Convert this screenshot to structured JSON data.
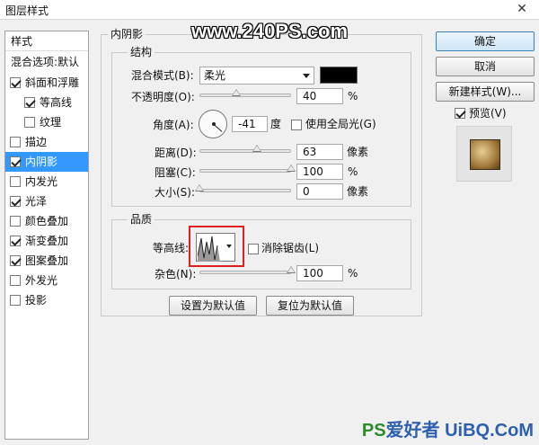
{
  "window": {
    "title": "图层样式",
    "close_glyph": "✕"
  },
  "watermark_top": "www.240PS.com",
  "sidebar": {
    "header": "样式",
    "blend_options": "混合选项:默认",
    "items": [
      {
        "label": "斜面和浮雕",
        "checked": true
      },
      {
        "label": "等高线",
        "checked": true
      },
      {
        "label": "纹理",
        "checked": false
      },
      {
        "label": "描边",
        "checked": false
      },
      {
        "label": "内阴影",
        "checked": true,
        "selected": true
      },
      {
        "label": "内发光",
        "checked": false
      },
      {
        "label": "光泽",
        "checked": true
      },
      {
        "label": "颜色叠加",
        "checked": false
      },
      {
        "label": "渐变叠加",
        "checked": true
      },
      {
        "label": "图案叠加",
        "checked": true
      },
      {
        "label": "外发光",
        "checked": false
      },
      {
        "label": "投影",
        "checked": false
      }
    ]
  },
  "panel": {
    "title": "内阴影",
    "structure": {
      "title": "结构",
      "blend_mode_label": "混合模式(B):",
      "blend_mode_value": "柔光",
      "opacity_label": "不透明度(O):",
      "opacity_value": "40",
      "percent": "%",
      "angle_label": "角度(A):",
      "angle_value": "-41",
      "degree": "度",
      "global_light_label": "使用全局光(G)",
      "global_light_checked": false,
      "distance_label": "距离(D):",
      "distance_value": "63",
      "px": "像素",
      "choke_label": "阻塞(C):",
      "choke_value": "100",
      "size_label": "大小(S):",
      "size_value": "0",
      "sliders": {
        "opacity": 0.4,
        "distance": 0.63,
        "choke": 1.0,
        "size": 0.0
      }
    },
    "quality": {
      "title": "品质",
      "contour_label": "等高线:",
      "antialias_label": "消除锯齿(L)",
      "antialias_checked": false,
      "noise_label": "杂色(N):",
      "noise_value": "100",
      "percent": "%",
      "noise_slider": 1.0
    },
    "set_default": "设置为默认值",
    "reset_default": "复位为默认值"
  },
  "actions": {
    "ok": "确定",
    "cancel": "取消",
    "new_style": "新建样式(W)...",
    "preview_label": "预览(V)",
    "preview_checked": true
  },
  "watermark_bottom": {
    "ps": "PS",
    "rest": "爱好者",
    "brand": "UiBQ.CoM"
  },
  "colors": {
    "selection": "#3399ff",
    "highlight_box": "#e02020",
    "swatch": "#000000"
  }
}
